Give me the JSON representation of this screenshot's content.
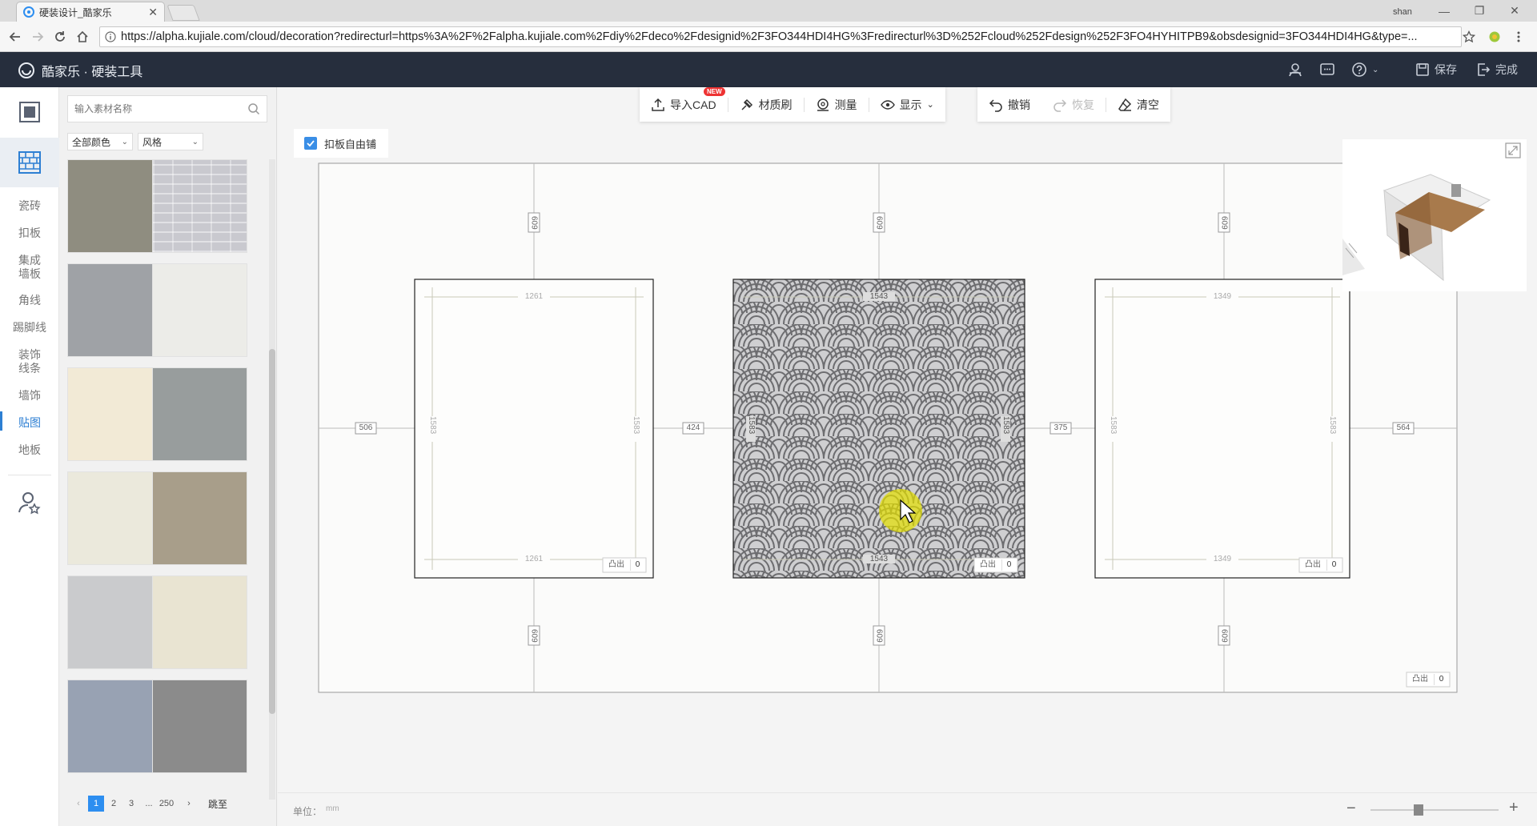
{
  "browser": {
    "tab_title": "硬装设计_酷家乐",
    "url": "https://alpha.kujiale.com/cloud/decoration?redirecturl=https%3A%2F%2Falpha.kujiale.com%2Fdiy%2Fdeco%2Fdesignid%2F3FO344HDI4HG%3Fredirecturl%3D%252Fcloud%252Fdesign%252F3FO4HYHITPB9&obsdesignid=3FO344HDI4HG&type=...",
    "user_label": "shan",
    "accent_color": "#2d8ef0"
  },
  "app": {
    "title": "酷家乐 · 硬装工具",
    "save_label": "保存",
    "done_label": "完成",
    "header_bg": "#262e3d"
  },
  "rail": {
    "items": [
      {
        "label": "瓷砖"
      },
      {
        "label": "扣板"
      },
      {
        "label": "集成\n墙板"
      },
      {
        "label": "角线"
      },
      {
        "label": "踢脚线"
      },
      {
        "label": "装饰\n线条"
      },
      {
        "label": "墙饰"
      },
      {
        "label": "贴图",
        "active": true
      },
      {
        "label": "地板"
      }
    ]
  },
  "panel": {
    "search_placeholder": "输入素材名称",
    "filter_color": "全部颜色",
    "filter_style": "风格",
    "swatches": [
      "#8f8d80",
      "#c9c9cf",
      "#9fa2a6",
      "#ecece8",
      "#f2ead6",
      "#989d9d",
      "#ebe9dc",
      "#a89e8a",
      "#cacbcd",
      "#e9e4d2",
      "#98a2b3",
      "#8b8b8b"
    ],
    "pager": {
      "prev": "‹",
      "pages": [
        "1",
        "2",
        "3"
      ],
      "ellipsis": "...",
      "last": "250",
      "next": "›",
      "jump": "跳至"
    }
  },
  "toolbar": {
    "import_cad": "导入CAD",
    "new_badge": "NEW",
    "material_brush": "材质刷",
    "measure": "测量",
    "display": "显示",
    "undo": "撤销",
    "redo": "恢复",
    "clear": "清空"
  },
  "canvas": {
    "free_tile_label": "扣板自由铺",
    "unit_label": "单位：",
    "unit_value": "mm",
    "bump_label": "凸出",
    "bump_value": "0",
    "dims": {
      "top": "609",
      "bottom": "609",
      "left_gap": "506",
      "gap1": "424",
      "gap2": "375",
      "right_gap": "564",
      "height": "1583",
      "w1": "1261",
      "w2": "1543",
      "w3": "1349"
    }
  }
}
